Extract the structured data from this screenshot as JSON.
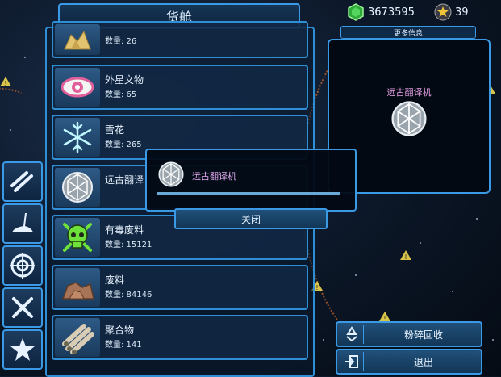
{
  "window": {
    "title": "货舱"
  },
  "currency": {
    "credits": "3673595",
    "stars": "39"
  },
  "cargo_items": [
    {
      "id": "crystal",
      "name": "",
      "qty_label": "数量: 26",
      "icon": "crystal-icon"
    },
    {
      "id": "alien-artifact",
      "name": "外星文物",
      "qty_label": "数量: 65",
      "icon": "eye-icon"
    },
    {
      "id": "snowflake",
      "name": "雪花",
      "qty_label": "数量: 265",
      "icon": "snowflake-icon"
    },
    {
      "id": "ancient-translator",
      "name": "远古翻译",
      "qty_label": "",
      "icon": "geodesic-sphere-icon"
    },
    {
      "id": "toxic-waste",
      "name": "有毒废料",
      "qty_label": "数量: 15121",
      "icon": "skull-icon"
    },
    {
      "id": "scrap",
      "name": "废料",
      "qty_label": "数量: 84146",
      "icon": "rock-pile-icon"
    },
    {
      "id": "polymer",
      "name": "聚合物",
      "qty_label": "数量: 141",
      "icon": "pipes-icon"
    }
  ],
  "side_tabs": [
    "pipes-icon",
    "boot-icon",
    "target-icon",
    "tools-icon",
    "star-icon"
  ],
  "info": {
    "header": "更多信息",
    "item_name": "远古翻译机"
  },
  "popup": {
    "item_name": "远古翻译机",
    "close_label": "关闭"
  },
  "actions": {
    "recycle_label": "粉碎回收",
    "exit_label": "退出"
  },
  "colors": {
    "accent": "#3a9ae6",
    "gem": "#3fc94a",
    "artifact": "#e0609a",
    "toxic": "#6ee23a"
  }
}
